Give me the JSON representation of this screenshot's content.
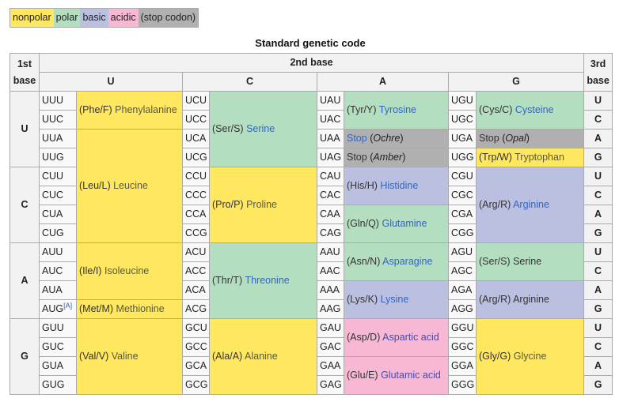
{
  "legend": [
    {
      "label": "nonpolar",
      "cls": "np"
    },
    {
      "label": "polar",
      "cls": "po"
    },
    {
      "label": "basic",
      "cls": "ba"
    },
    {
      "label": "acidic",
      "cls": "ac"
    },
    {
      "label": "(stop codon)",
      "cls": "st"
    }
  ],
  "colors": {
    "nonpolar": "#ffe75f",
    "polar": "#b3dec0",
    "basic": "#bbbfe0",
    "acidic": "#f8b7d3",
    "stop": "#b0b0b0",
    "link": "#3366bb"
  },
  "caption": "Standard genetic code",
  "header": {
    "first_base": "1st base",
    "second_base": "2nd base",
    "third_base": "3rd base",
    "second_bases": [
      "U",
      "C",
      "A",
      "G"
    ]
  },
  "blocks": [
    {
      "first": "U",
      "third": [
        "U",
        "C",
        "A",
        "G"
      ],
      "codons": [
        [
          "UUU",
          "UCU",
          "UAU",
          "UGU"
        ],
        [
          "UUC",
          "UCC",
          "UAC",
          "UGC"
        ],
        [
          "UUA",
          "UCA",
          "UAA",
          "UGA"
        ],
        [
          "UUG",
          "UCG",
          "UAG",
          "UGG"
        ]
      ]
    },
    {
      "first": "C",
      "third": [
        "U",
        "C",
        "A",
        "G"
      ],
      "codons": [
        [
          "CUU",
          "CCU",
          "CAU",
          "CGU"
        ],
        [
          "CUC",
          "CCC",
          "CAC",
          "CGC"
        ],
        [
          "CUA",
          "CCA",
          "CAA",
          "CGA"
        ],
        [
          "CUG",
          "CCG",
          "CAG",
          "CGG"
        ]
      ]
    },
    {
      "first": "A",
      "third": [
        "U",
        "C",
        "A",
        "G"
      ],
      "codons": [
        [
          "AUU",
          "ACU",
          "AAU",
          "AGU"
        ],
        [
          "AUC",
          "ACC",
          "AAC",
          "AGC"
        ],
        [
          "AUA",
          "ACA",
          "AAA",
          "AGA"
        ],
        [
          "AUG",
          "ACG",
          "AAG",
          "AGG"
        ]
      ],
      "aug_footnote": "[A]"
    },
    {
      "first": "G",
      "third": [
        "U",
        "C",
        "A",
        "G"
      ],
      "codons": [
        [
          "GUU",
          "GCU",
          "GAU",
          "GGU"
        ],
        [
          "GUC",
          "GCC",
          "GAC",
          "GGC"
        ],
        [
          "GUA",
          "GCA",
          "GAA",
          "GGA"
        ],
        [
          "GUG",
          "GCG",
          "GAG",
          "GGG"
        ]
      ]
    }
  ],
  "amino": {
    "phe": {
      "abbr": "(Phe/F)",
      "name": "Phenylalanine"
    },
    "leu": {
      "abbr": "(Leu/L)",
      "name": "Leucine"
    },
    "ile": {
      "abbr": "(Ile/I)",
      "name": "Isoleucine"
    },
    "met": {
      "abbr": "(Met/M)",
      "name": "Methionine"
    },
    "val": {
      "abbr": "(Val/V)",
      "name": "Valine"
    },
    "ser1": {
      "abbr": "(Ser/S)",
      "name": "Serine"
    },
    "pro": {
      "abbr": "(Pro/P)",
      "name": "Proline"
    },
    "thr": {
      "abbr": "(Thr/T)",
      "name": "Threonine"
    },
    "ala": {
      "abbr": "(Ala/A)",
      "name": "Alanine"
    },
    "tyr": {
      "abbr": "(Tyr/Y)",
      "name": "Tyrosine"
    },
    "ochre": {
      "abbr": "Stop",
      "name": "Ochre"
    },
    "amber": {
      "abbr": "Stop",
      "name": "Amber"
    },
    "his": {
      "abbr": "(His/H)",
      "name": "Histidine"
    },
    "gln": {
      "abbr": "(Gln/Q)",
      "name": "Glutamine"
    },
    "asn": {
      "abbr": "(Asn/N)",
      "name": "Asparagine"
    },
    "lys": {
      "abbr": "(Lys/K)",
      "name": "Lysine"
    },
    "asp": {
      "abbr": "(Asp/D)",
      "name": "Aspartic acid"
    },
    "glu": {
      "abbr": "(Glu/E)",
      "name": "Glutamic acid"
    },
    "cys": {
      "abbr": "(Cys/C)",
      "name": "Cysteine"
    },
    "opal": {
      "abbr": "Stop",
      "name": "Opal"
    },
    "trp": {
      "abbr": "(Trp/W)",
      "name": "Tryptophan"
    },
    "arg1": {
      "abbr": "(Arg/R)",
      "name": "Arginine"
    },
    "ser2": {
      "abbr": "(Ser/S)",
      "name": "Serine"
    },
    "arg2": {
      "abbr": "(Arg/R)",
      "name": "Arginine"
    },
    "gly": {
      "abbr": "(Gly/G)",
      "name": "Glycine"
    }
  }
}
